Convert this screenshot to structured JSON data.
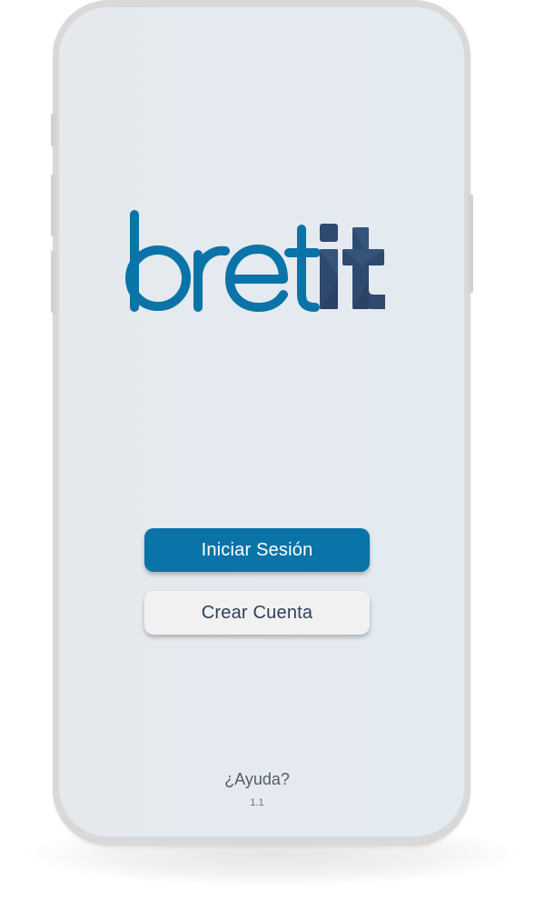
{
  "app": {
    "brand_text": "bretit",
    "logo_colors": {
      "primary": "#0a73a8",
      "accent": "#2f4a6f"
    }
  },
  "actions": {
    "login_label": "Iniciar Sesión",
    "create_account_label": "Crear Cuenta"
  },
  "footer": {
    "help_label": "¿Ayuda?",
    "version": "1.1"
  },
  "colors": {
    "primary_button": "#0a73a8",
    "secondary_button": "#f1f1f2",
    "screen_background": "#e4eaef"
  }
}
